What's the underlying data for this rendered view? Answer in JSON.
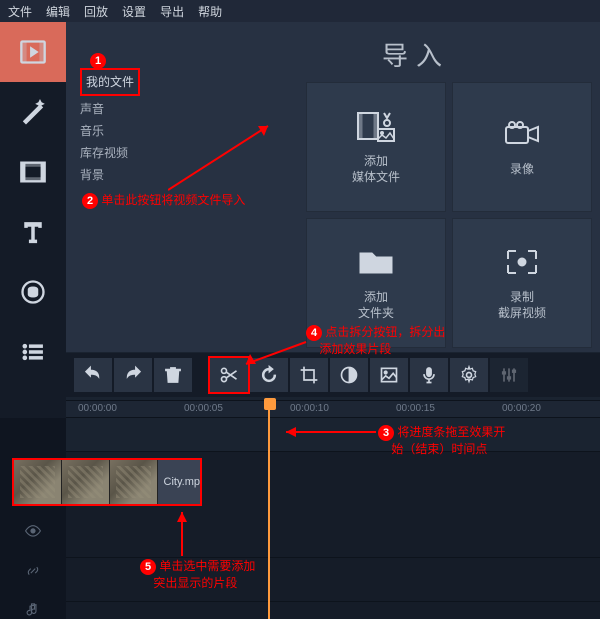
{
  "menu": {
    "file": "文件",
    "edit": "编辑",
    "playback": "回放",
    "settings": "设置",
    "export": "导出",
    "help": "帮助"
  },
  "import": {
    "title": "导入",
    "sources": {
      "my_files": "我的文件",
      "sound": "声音",
      "music": "音乐",
      "stock": "库存视频",
      "bg": "背景"
    },
    "tiles": {
      "add_media_l1": "添加",
      "add_media_l2": "媒体文件",
      "record_cam": "录像",
      "add_folder_l1": "添加",
      "add_folder_l2": "文件夹",
      "record_screen_l1": "录制",
      "record_screen_l2": "截屏视频"
    }
  },
  "timeline": {
    "ticks": [
      "00:00:00",
      "00:00:05",
      "00:00:10",
      "00:00:15",
      "00:00:20"
    ],
    "clip_label": "City.mp"
  },
  "annotations": {
    "a2": "单击此按钮将视频文件导入",
    "a4_l1": "点击拆分按钮，拆分出",
    "a4_l2": "添加效果片段",
    "a3_l1": "将进度条拖至效果开",
    "a3_l2": "始（结束）时间点",
    "a5_l1": "单击选中需要添加",
    "a5_l2": "突出显示的片段"
  },
  "badges": {
    "b1": "1",
    "b2": "2",
    "b3": "3",
    "b4": "4",
    "b5": "5"
  }
}
